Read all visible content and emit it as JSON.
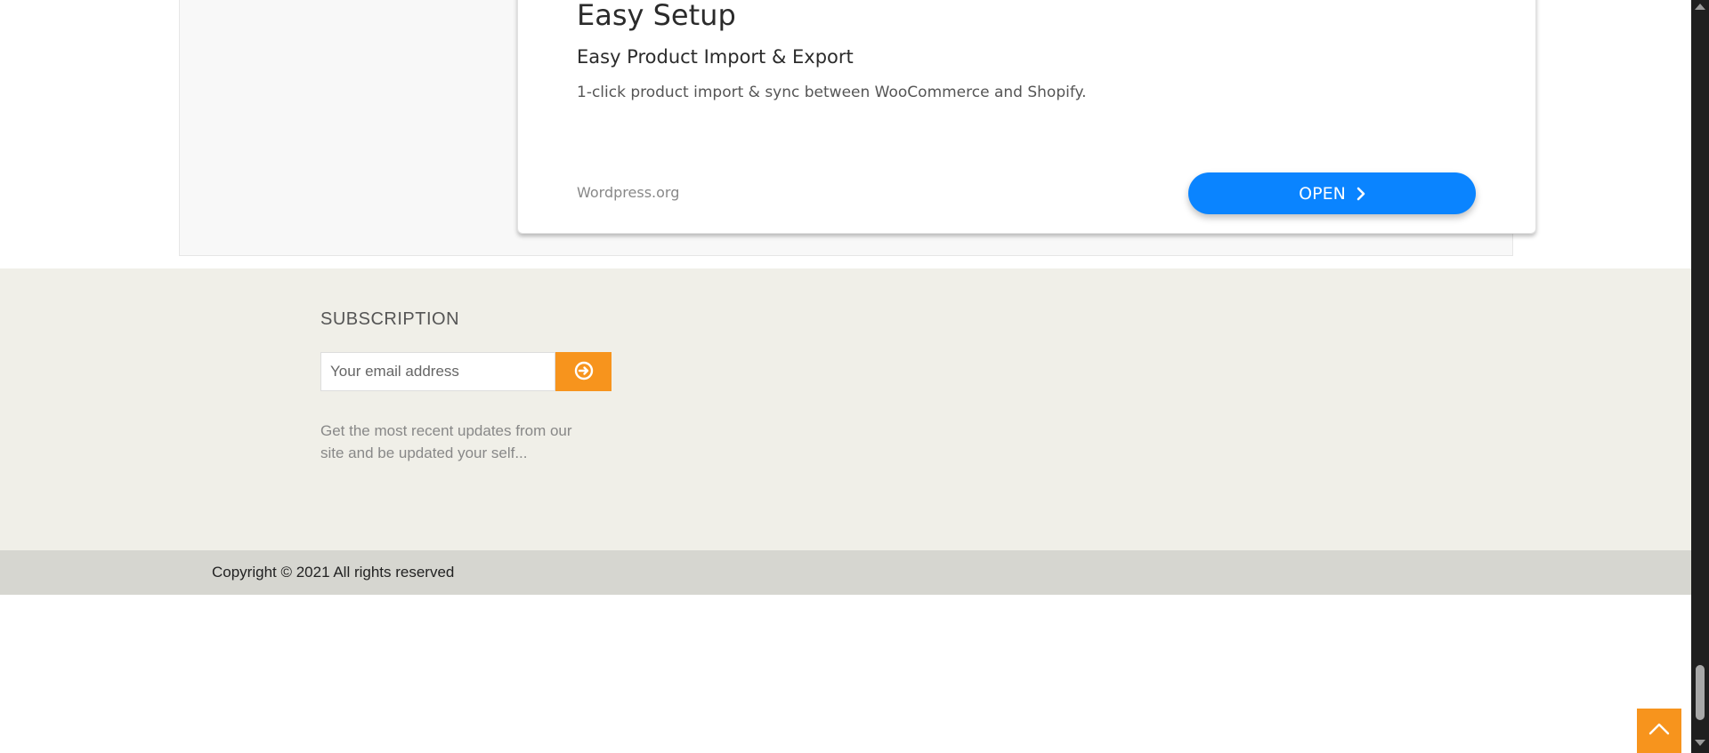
{
  "app_card": {
    "title": "Easy Setup",
    "subtitle": "Easy Product Import & Export",
    "description": "1-click product import & sync between WooCommerce and Shopify.",
    "source": "Wordpress.org",
    "open_label": "OPEN",
    "open_icon": "chevron-right-icon",
    "button_color": "#0a84ff"
  },
  "subscription": {
    "heading": "SUBSCRIPTION",
    "email_placeholder": "Your email address",
    "submit_icon": "arrow-circle-right-icon",
    "description": "Get the most recent updates from our site and be updated your self...",
    "accent_color": "#f7941d"
  },
  "footer": {
    "copyright": "Copyright © 2021 All rights reserved"
  },
  "back_to_top": {
    "icon": "chevron-up-icon"
  }
}
